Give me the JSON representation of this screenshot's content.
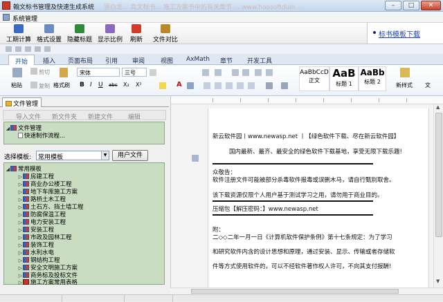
{
  "window": {
    "title": "翰文标书管理及快速生成系统",
    "ghost_text": "雪白龙... 高文标书... 施工方案书中的有关章节 ... www.haosoftduin ... ",
    "controls": [
      "–",
      "□",
      "✕"
    ]
  },
  "sysmenu": {
    "label": "系统管理"
  },
  "toolbar": {
    "buttons": [
      {
        "label": "工期计算",
        "icon": "calendar-calc-icon",
        "color": "#3a6bc4"
      },
      {
        "label": "格式设置",
        "icon": "format-settings-icon",
        "color": "#6d8cc4"
      },
      {
        "label": "隐藏标题",
        "icon": "hide-title-icon",
        "color": "#2f8a3a"
      },
      {
        "label": "显示比例",
        "icon": "zoom-ratio-icon",
        "color": "#8a6ac0"
      },
      {
        "label": "刷新",
        "icon": "refresh-icon",
        "color": "#d23a2a"
      },
      {
        "label": "文件对比",
        "icon": "file-compare-icon",
        "color": "#b88a2a"
      }
    ]
  },
  "link_panel": {
    "link_text": "标书模板下载"
  },
  "ribbon": {
    "tabs": [
      "开始",
      "插入",
      "页面布局",
      "引用",
      "审阅",
      "视图",
      "AxMath",
      "章节",
      "开发工具"
    ],
    "active_tab": "开始",
    "clipboard": {
      "paste": "粘贴",
      "cut": "剪切",
      "copy": "复制",
      "format_painter": "格式刷"
    },
    "font": {
      "name": "宋体",
      "size": "三号",
      "buttons": [
        "B",
        "I",
        "U",
        "abc",
        "X₂",
        "X²",
        "A"
      ]
    },
    "styles": [
      {
        "preview": "AaBbCcD",
        "name": "正文"
      },
      {
        "preview": "AaB",
        "name": "标题 1"
      },
      {
        "preview": "AaBb",
        "name": "标题 2"
      }
    ],
    "new_style": "新样式",
    "extra": "文"
  },
  "left_panel": {
    "tab_label": "文件管理",
    "buttons": [
      "导入文件",
      "新文件夹",
      "新建文件",
      "编辑"
    ],
    "tree_top": {
      "root": "文件管理",
      "child": "快速制作流程..."
    },
    "template_label": "选择模板:",
    "template_value": "常用模板",
    "user_files_button": "用户文件",
    "tree_bottom": {
      "root": "常用模板",
      "items": [
        "房建工程",
        "商业办公楼工程",
        "地下车库施工方案",
        "路桥土木工程",
        "土石方、挡土墙工程",
        "防腐保温工程",
        "电力安装工程",
        "安装工程",
        "市政及园林工程",
        "装饰工程",
        "水利水电",
        "钢结构工程",
        "安全文明施工方案",
        "商务标及投标文件",
        "施工方案常用表格"
      ]
    }
  },
  "document": {
    "lines": [
      "新云软件园丨www.newasp.net 丨【绿色软件下载、尽在新云软件园】",
      "国内最新、最齐、最安全的绿色软件下载基地，享受无限下载乐趣!",
      "众敬告：",
      "  软件注册文件可能被部分杀毒软件报毒或误删木马，请自行甄别取舍。",
      "  该下载资源仅限个人用户基于测试学习之用，请勿用于商业目的。",
      "压缩包【解压密码：】www.newasp.net",
      "附：",
      "  二◇◇二年一月一日《计算机软件保护条例》第十七条规定：为了学习",
      "和研究软件内含的设计思想和原理，通过安装、显示、传输或者存储软",
      "件等方式使用软件的，可以不经软件著作权人许可，不向其支付报酬!"
    ]
  }
}
